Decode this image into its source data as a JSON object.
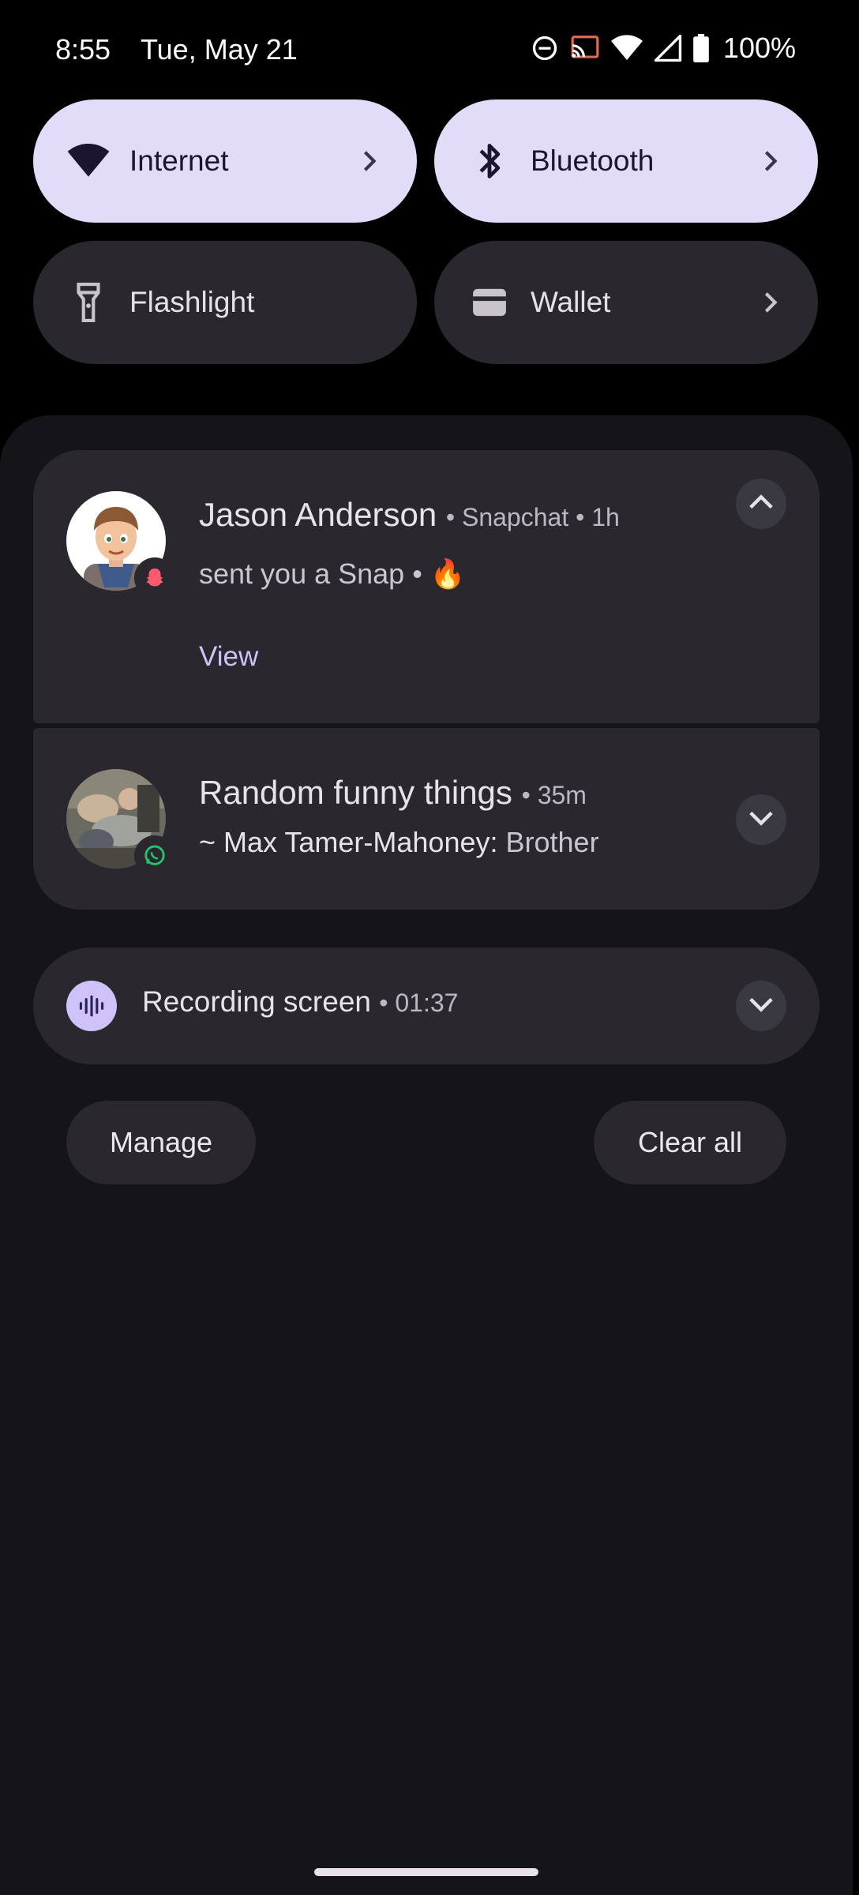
{
  "status_bar": {
    "time": "8:55",
    "date": "Tue, May 21",
    "battery_percent": "100%",
    "icons": [
      "dnd-icon",
      "cast-icon",
      "wifi-icon",
      "signal-icon",
      "battery-icon"
    ]
  },
  "quick_settings": {
    "tiles": [
      {
        "label": "Internet",
        "icon": "wifi-icon",
        "active": true,
        "has_chevron": true
      },
      {
        "label": "Bluetooth",
        "icon": "bluetooth-icon",
        "active": true,
        "has_chevron": true
      },
      {
        "label": "Flashlight",
        "icon": "flashlight-icon",
        "active": false,
        "has_chevron": false
      },
      {
        "label": "Wallet",
        "icon": "wallet-icon",
        "active": false,
        "has_chevron": true
      }
    ]
  },
  "notifications": [
    {
      "title": "Jason Anderson",
      "app": "Snapchat",
      "time": "1h",
      "body": "sent you a Snap • 🔥",
      "action": "View",
      "expanded": true,
      "app_icon": "snapchat-icon"
    },
    {
      "title": "Random funny things",
      "time": "35m",
      "sender": "~ Max Tamer-Mahoney:",
      "message": "Brother",
      "expanded": false,
      "app_icon": "whatsapp-icon"
    },
    {
      "title": "Recording screen",
      "time": "01:37",
      "expanded": false,
      "app_icon": "screen-record-icon"
    }
  ],
  "footer": {
    "manage_label": "Manage",
    "clear_all_label": "Clear all"
  },
  "colors": {
    "tile_active": "#e3dcf9",
    "tile_inactive": "#2a282e",
    "card_bg": "#2a282e",
    "shade_bg": "#151419",
    "accent_text": "#cfc2f8"
  }
}
